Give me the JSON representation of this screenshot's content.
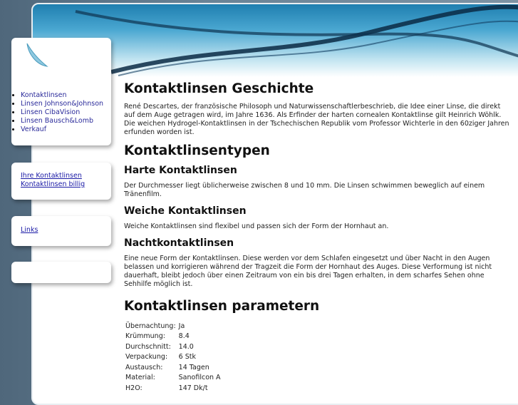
{
  "nav": {
    "items": [
      "Kontaktlinsen",
      "Linsen Johnson&Johnson",
      "Linsen CibaVision",
      "Linsen Bausch&Lomb",
      "Verkauf"
    ]
  },
  "links1": [
    "Ihre Kontaktlinsen",
    "Kontaktlinsen billig"
  ],
  "links2": [
    "Links"
  ],
  "content": {
    "h1_history": "Kontaktlinsen Geschichte",
    "p_history": "René Descartes, der französische Philosoph und Naturwissenschaftlerbeschrieb, die Idee einer Linse, die direkt auf dem Auge getragen wird, im Jahre 1636. Als Erfinder der harten cornealen Kontaktlinse gilt Heinrich Wöhlk. Die weichen Hydrogel-Kontaktlinsen in der Tschechischen Republik vom Professor Wichterle in den 60ziger Jahren erfunden worden ist.",
    "h1_types": "Kontaktlinsentypen",
    "h2_hard": "Harte Kontaktlinsen",
    "p_hard": "Der Durchmesser liegt üblicherweise zwischen 8 und 10 mm. Die Linsen schwimmen beweglich auf einem Tränenfilm.",
    "h2_soft": "Weiche Kontaktlinsen",
    "p_soft": "Weiche Kontaktlinsen sind flexibel und passen sich der Form der Hornhaut an.",
    "h2_night": "Nachtkontaktlinsen",
    "p_night": "Eine neue Form der Kontaktlinsen. Diese werden vor dem Schlafen eingesetzt und über Nacht in den Augen belassen und korrigieren während der Tragzeit die Form der Hornhaut des Auges. Diese Verformung ist nicht dauerhaft, bleibt jedoch über einen Zeitraum von ein bis drei Tagen erhalten, in dem scharfes Sehen ohne Sehhilfe möglich ist.",
    "h1_params": "Kontaktlinsen parametern",
    "params": [
      [
        "Übernachtung:",
        "Ja"
      ],
      [
        "Krümmung:",
        "8.4"
      ],
      [
        "Durchschnitt:",
        "14.0"
      ],
      [
        "Verpackung:",
        "6 Stk"
      ],
      [
        "Austausch:",
        "14 Tagen"
      ],
      [
        "Material:",
        "Sanofilcon A"
      ],
      [
        "H2O:",
        "147 Dk/t"
      ]
    ]
  }
}
